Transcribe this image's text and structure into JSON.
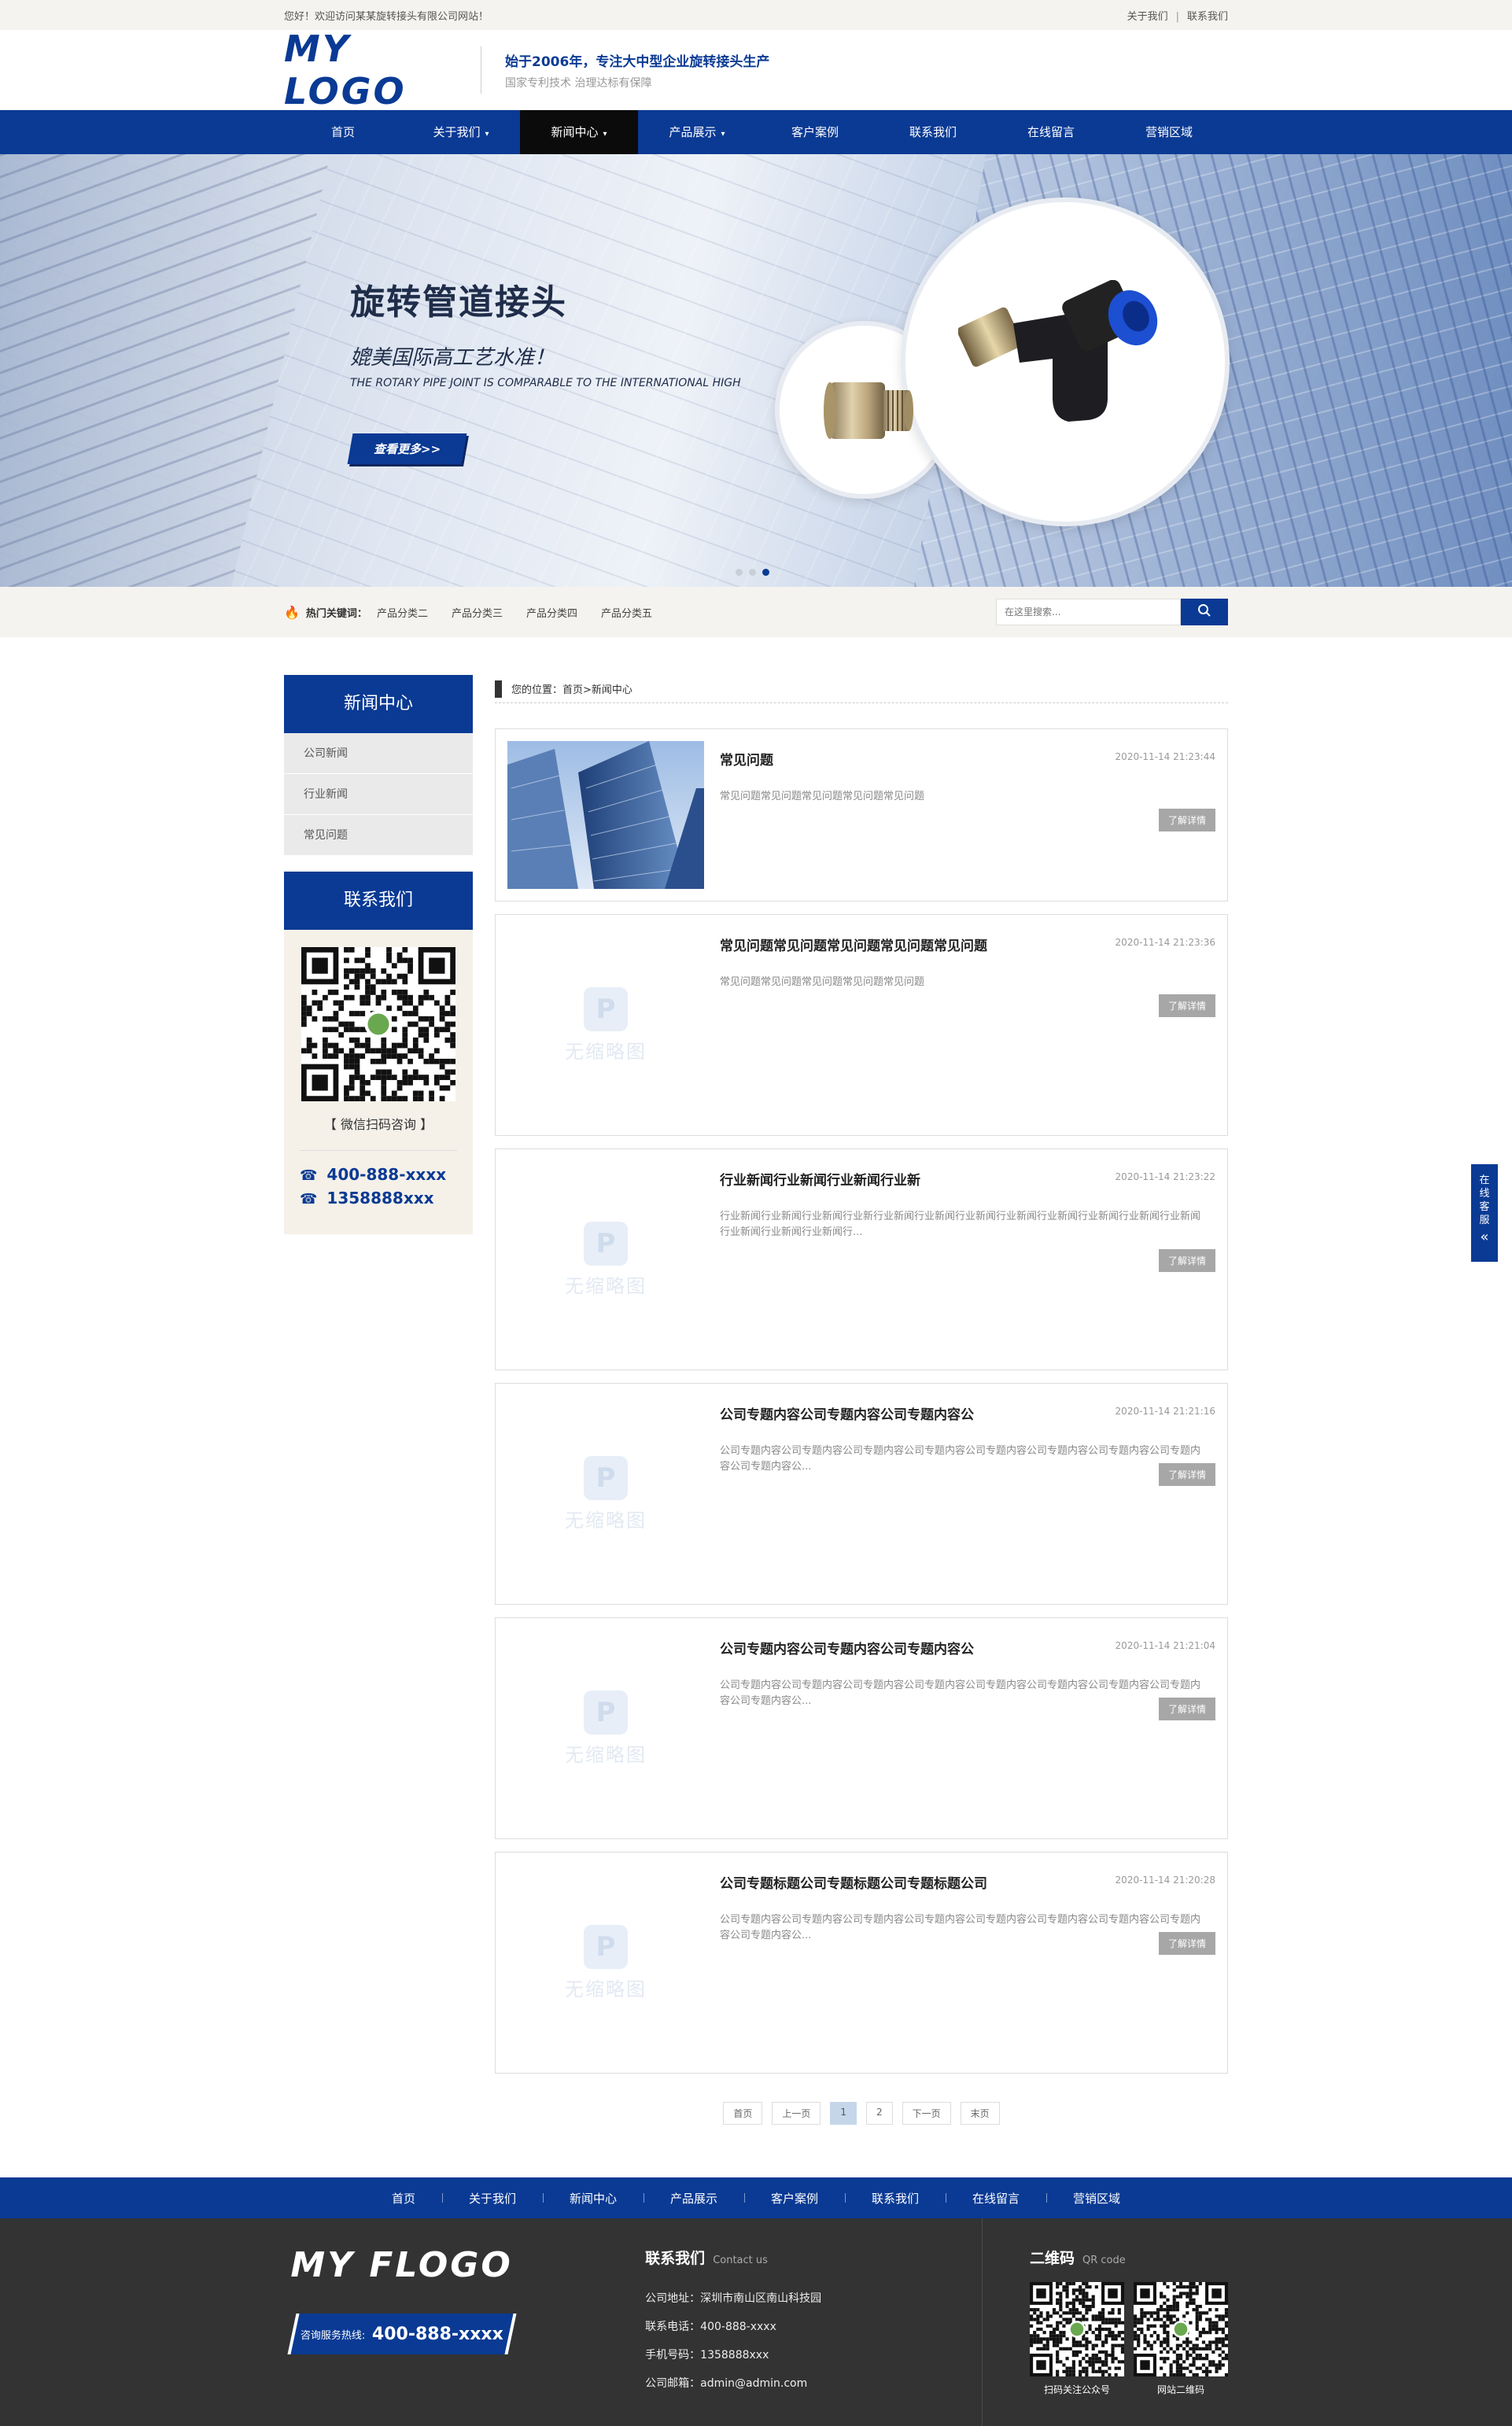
{
  "topbar": {
    "welcome": "您好！欢迎访问某某旋转接头有限公司网站！",
    "links": [
      "关于我们",
      "联系我们"
    ],
    "separator": "|"
  },
  "header": {
    "logo": "MY LOGO",
    "slogan_main": "始于2006年，专注大中型企业旋转接头生产",
    "slogan_sub": "国家专利技术 治理达标有保障"
  },
  "nav": {
    "items": [
      {
        "label": "首页",
        "caret": ""
      },
      {
        "label": "关于我们",
        "caret": "▾"
      },
      {
        "label": "新闻中心",
        "caret": "▾"
      },
      {
        "label": "产品展示",
        "caret": "▾"
      },
      {
        "label": "客户案例",
        "caret": ""
      },
      {
        "label": "联系我们",
        "caret": ""
      },
      {
        "label": "在线留言",
        "caret": ""
      },
      {
        "label": "营销区域",
        "caret": ""
      }
    ],
    "active_index": 2
  },
  "banner": {
    "title": "旋转管道接头",
    "subtitle": "媲美国际高工艺水准！",
    "english": "THE ROTARY PIPE JOINT IS COMPARABLE TO THE INTERNATIONAL HIGH",
    "button": "查看更多>>",
    "slide_count": 3,
    "active_slide": 3
  },
  "search": {
    "hot_label": "热门关键词：",
    "keywords": [
      "产品分类二",
      "产品分类三",
      "产品分类四",
      "产品分类五"
    ],
    "placeholder": "在这里搜索..."
  },
  "sidebar": {
    "title": "新闻中心",
    "items": [
      "公司新闻",
      "行业新闻",
      "常见问题"
    ],
    "contact_title": "联系我们",
    "qr_caption": "【 微信扫码咨询 】",
    "phone1": "400-888-xxxx",
    "phone2": "1358888xxx"
  },
  "breadcrumb": {
    "label": "您的位置：",
    "path": "首页>新闻中心"
  },
  "news": [
    {
      "title": "常见问题",
      "date": "2020-11-14 21:23:44",
      "desc": "常见问题常见问题常见问题常见问题常见问题",
      "more": "了解详情",
      "image": "building-photo"
    },
    {
      "title": "常见问题常见问题常见问题常见问题常见问题",
      "date": "2020-11-14 21:23:36",
      "desc": "常见问题常见问题常见问题常见问题常见问题",
      "more": "了解详情",
      "image": "placeholder"
    },
    {
      "title": "行业新闻行业新闻行业新闻行业新",
      "date": "2020-11-14 21:23:22",
      "desc": "行业新闻行业新闻行业新闻行业新行业新闻行业新闻行业新闻行业新闻行业新闻行业新闻行业新闻行业新闻行业新闻行业新闻行业新闻行...",
      "more": "了解详情",
      "image": "placeholder"
    },
    {
      "title": "公司专题内容公司专题内容公司专题内容公",
      "date": "2020-11-14 21:21:16",
      "desc": "公司专题内容公司专题内容公司专题内容公司专题内容公司专题内容公司专题内容公司专题内容公司专题内容公司专题内容公...",
      "more": "了解详情",
      "image": "placeholder"
    },
    {
      "title": "公司专题内容公司专题内容公司专题内容公",
      "date": "2020-11-14 21:21:04",
      "desc": "公司专题内容公司专题内容公司专题内容公司专题内容公司专题内容公司专题内容公司专题内容公司专题内容公司专题内容公...",
      "more": "了解详情",
      "image": "placeholder"
    },
    {
      "title": "公司专题标题公司专题标题公司专题标题公司",
      "date": "2020-11-14 21:20:28",
      "desc": "公司专题内容公司专题内容公司专题内容公司专题内容公司专题内容公司专题内容公司专题内容公司专题内容公司专题内容公...",
      "more": "了解详情",
      "image": "placeholder"
    }
  ],
  "placeholder_text": "无缩略图",
  "pager": {
    "items": [
      "首页",
      "上一页",
      "1",
      "2",
      "下一页",
      "末页"
    ],
    "current": "1"
  },
  "footer_nav": [
    "首页",
    "关于我们",
    "新闻中心",
    "产品展示",
    "客户案例",
    "联系我们",
    "在线留言",
    "营销区域"
  ],
  "footer": {
    "logo": "MY FLOGO",
    "hotline_label": "咨询服务热线:",
    "hotline": "400-888-xxxx",
    "contact_title": "联系我们",
    "contact_en": "Contact us",
    "address": "公司地址：深圳市南山区南山科技园",
    "tel": "联系电话：400-888-xxxx",
    "mobile": "手机号码：1358888xxx",
    "email": "公司邮箱：admin@admin.com",
    "qr_title": "二维码",
    "qr_en": "QR code",
    "qr1_caption": "扫码关注公众号",
    "qr2_caption": "网站二维码"
  },
  "online_service": {
    "label": "在线客服",
    "arrow": "«"
  },
  "colors": {
    "brand_blue": "#0a3a94",
    "nav_active": "#0b0b0b",
    "topbar_bg": "#f5f3ef",
    "footer_bg": "#333333",
    "more_button": "#a7a7a7"
  }
}
